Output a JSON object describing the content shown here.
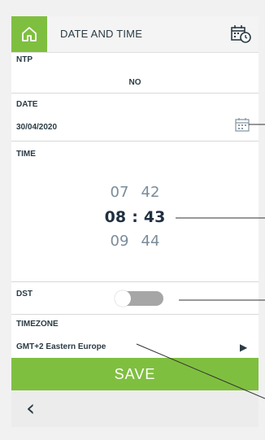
{
  "header": {
    "title": "DATE AND TIME"
  },
  "ntp": {
    "label": "NTP",
    "value": "NO"
  },
  "date": {
    "label": "DATE",
    "value": "30/04/2020"
  },
  "time": {
    "label": "TIME",
    "prev": {
      "hour": "07",
      "minute": "42"
    },
    "selected": {
      "hour": "08",
      "separator": ":",
      "minute": "43"
    },
    "next": {
      "hour": "09",
      "minute": "44"
    }
  },
  "dst": {
    "label": "DST",
    "enabled": false
  },
  "timezone": {
    "label": "TIMEZONE",
    "value": "GMT+2 Eastern Europe"
  },
  "save": {
    "label": "SAVE"
  },
  "colors": {
    "accent": "#7fbf3f",
    "text": "#2a3b44",
    "toggle_off": "#a6a6a6"
  },
  "icons": [
    "home-icon",
    "calendar-clock-icon",
    "calendar-icon",
    "play-arrow-icon",
    "chevron-left-icon"
  ]
}
